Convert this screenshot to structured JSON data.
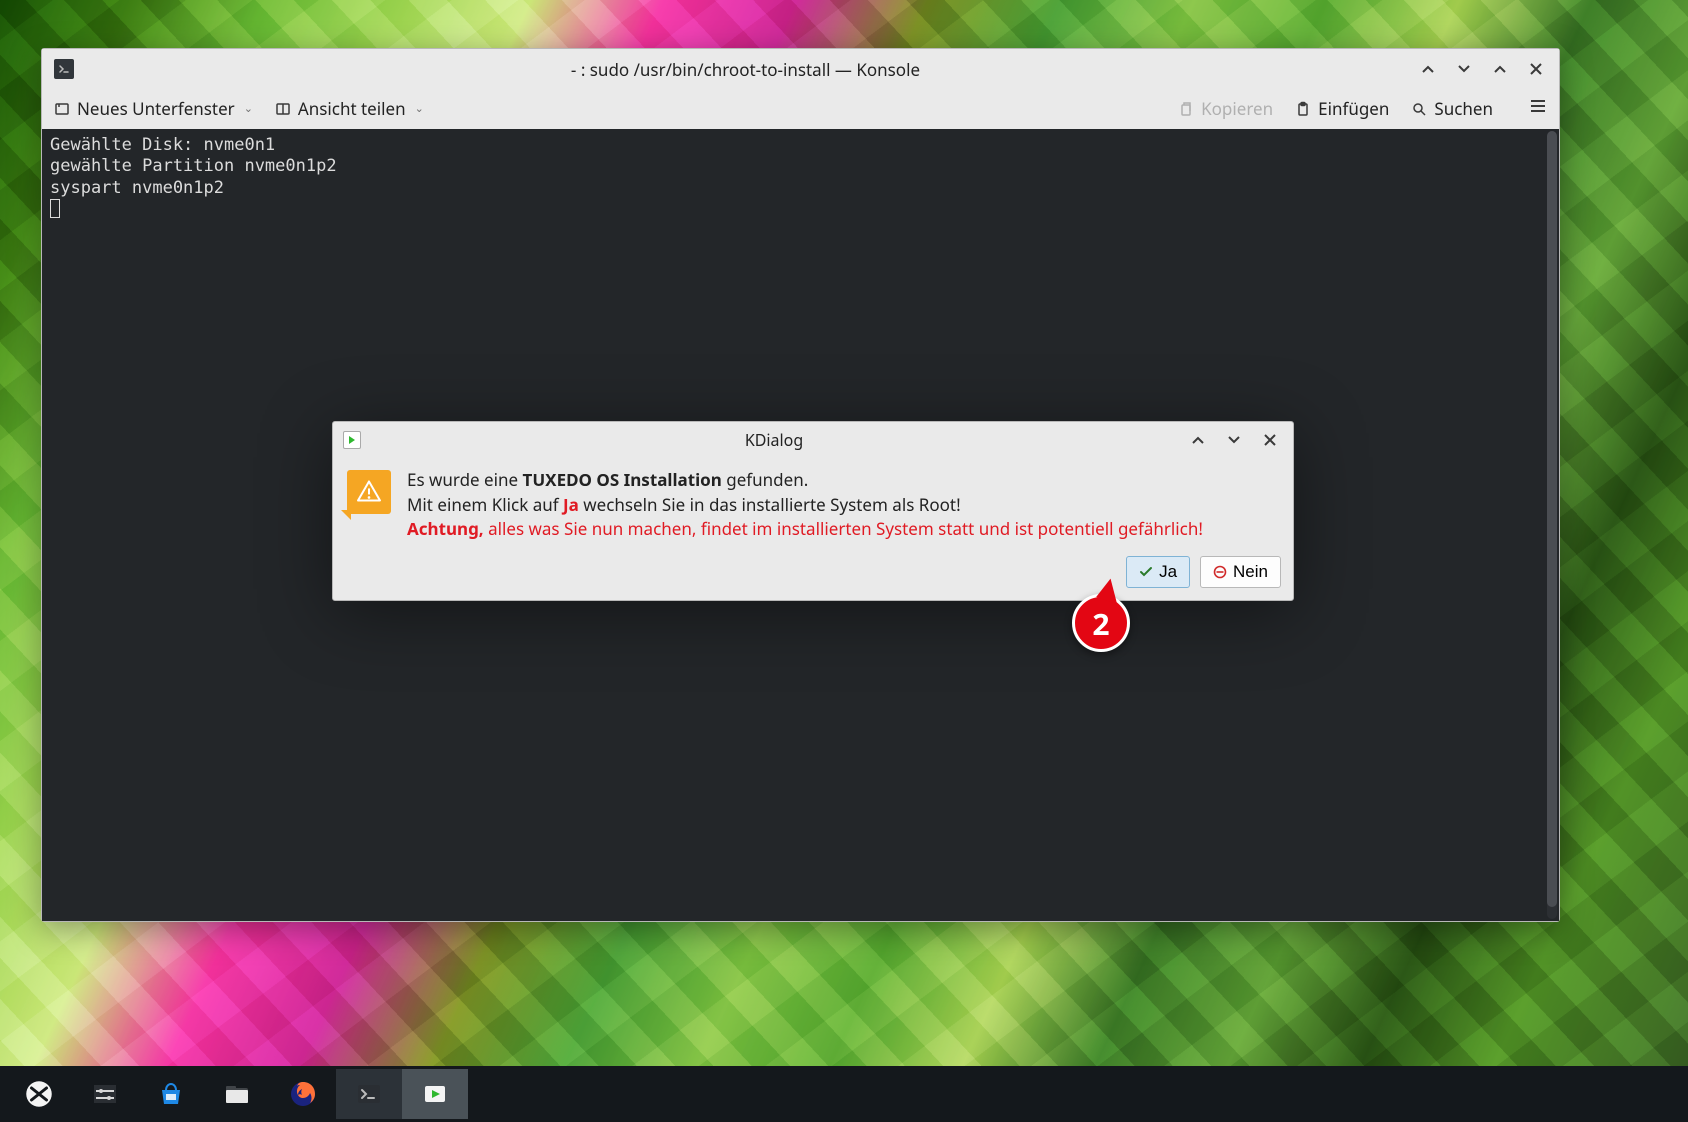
{
  "konsole": {
    "window_title": "- : sudo /usr/bin/chroot-to-install — Konsole",
    "toolbar": {
      "new_tab": "Neues Unterfenster",
      "split_view": "Ansicht teilen",
      "copy": "Kopieren",
      "paste": "Einfügen",
      "search": "Suchen"
    },
    "terminal_lines": [
      "Gewählte Disk: nvme0n1",
      "gewählte Partition nvme0n1p2",
      "syspart nvme0n1p2"
    ]
  },
  "kdialog": {
    "title": "KDialog",
    "msg_line1_prefix": "Es wurde eine ",
    "msg_line1_bold": "TUXEDO OS Installation",
    "msg_line1_suffix": " gefunden.",
    "msg_line2_prefix": "Mit einem Klick auf ",
    "msg_line2_ja": "Ja",
    "msg_line2_suffix": " wechseln Sie in das installierte System als Root!",
    "msg_line3_bold": "Achtung,",
    "msg_line3_rest": " alles was Sie nun machen, findet im installierten System statt und ist potentiell gefährlich!",
    "btn_yes": "Ja",
    "btn_no": "Nein"
  },
  "annotation": {
    "number": "2"
  }
}
